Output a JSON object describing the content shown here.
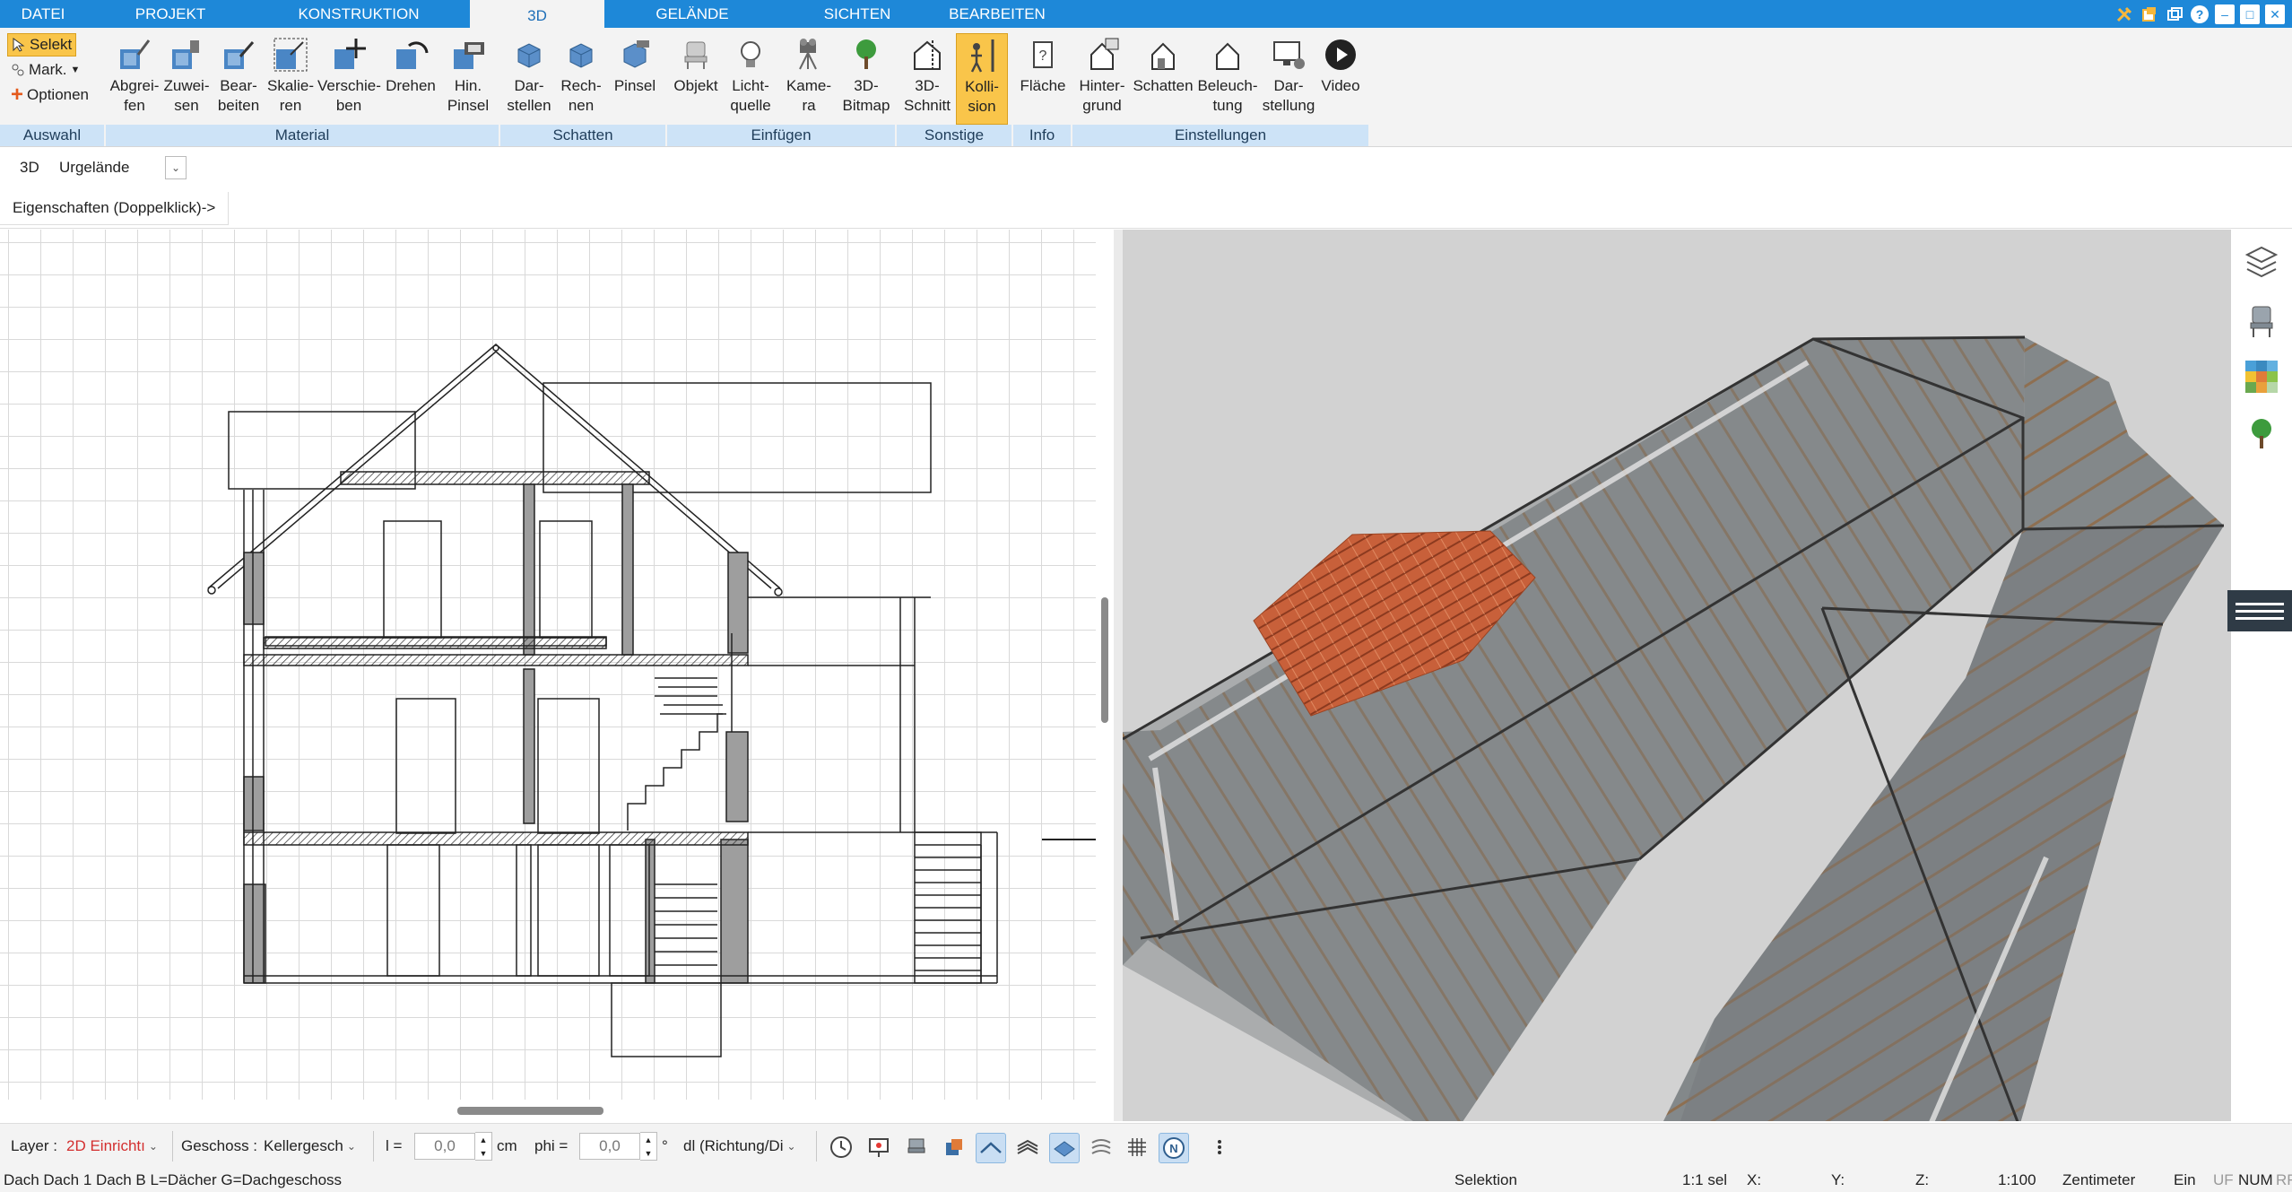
{
  "menu": {
    "tabs": [
      "DATEI",
      "PROJEKT",
      "KONSTRUKTION",
      "3D",
      "GELÄNDE",
      "SICHTEN",
      "BEARBEITEN"
    ],
    "active": "3D"
  },
  "ribbon": {
    "auswahl": {
      "selekt": "Selekt",
      "mark": "Mark.",
      "optionen": "Optionen",
      "group": "Auswahl"
    },
    "material": {
      "group": "Material",
      "buttons": [
        "Abgrei-\nfen",
        "Zuwei-\nsen",
        "Bear-\nbeiten",
        "Skalie-\nren",
        "Verschie-\nben",
        "Drehen",
        "Hin.\nPinsel"
      ]
    },
    "schatten": {
      "group": "Schatten",
      "buttons": [
        "Dar-\nstellen",
        "Rech-\nnen",
        "Pinsel"
      ]
    },
    "einfuegen": {
      "group": "Einfügen",
      "buttons": [
        "Objekt",
        "Licht-\nquelle",
        "Kame-\nra",
        "3D-\nBitmap"
      ]
    },
    "sonstige": {
      "group": "Sonstige",
      "buttons": [
        "3D-\nSchnitt",
        "Kolli-\nsion"
      ]
    },
    "info": {
      "group": "Info",
      "buttons": [
        "Fläche"
      ]
    },
    "einstellungen": {
      "group": "Einstellungen",
      "buttons": [
        "Hinter-\ngrund",
        "Schatten",
        "Beleuch-\ntung",
        "Dar-\nstellung",
        "Video"
      ]
    }
  },
  "toolbar2": {
    "mode": "3D",
    "terrain": "Urgelände"
  },
  "properties_label": "Eigenschaften (Doppelklick)->",
  "bottombar": {
    "layer_label": "Layer :",
    "layer_value": "2D Einrichtı",
    "geschoss_label": "Geschoss :",
    "geschoss_value": "Kellergesch",
    "l_label": "l =",
    "l_value": "0,0",
    "l_unit": "cm",
    "phi_label": "phi =",
    "phi_value": "0,0",
    "phi_unit": "°",
    "direction_value": "dl (Richtung/Di"
  },
  "status": {
    "left": "Dach Dach 1 Dach B L=Dächer G=Dachgeschoss",
    "mode": "Selektion",
    "sel": "1:1 sel",
    "x": "X:",
    "y": "Y:",
    "z": "Z:",
    "scale": "1:100",
    "unit": "Zentimeter",
    "ein": "Ein",
    "uf": "UF",
    "num": "NUM",
    "rf": "RF"
  },
  "colors": {
    "menubar": "#1e88d8",
    "ribbon_group": "#cde3f7",
    "active_button": "#f9c54a",
    "layer_value": "#d32f2f",
    "roof_tile": "#c8603a"
  }
}
